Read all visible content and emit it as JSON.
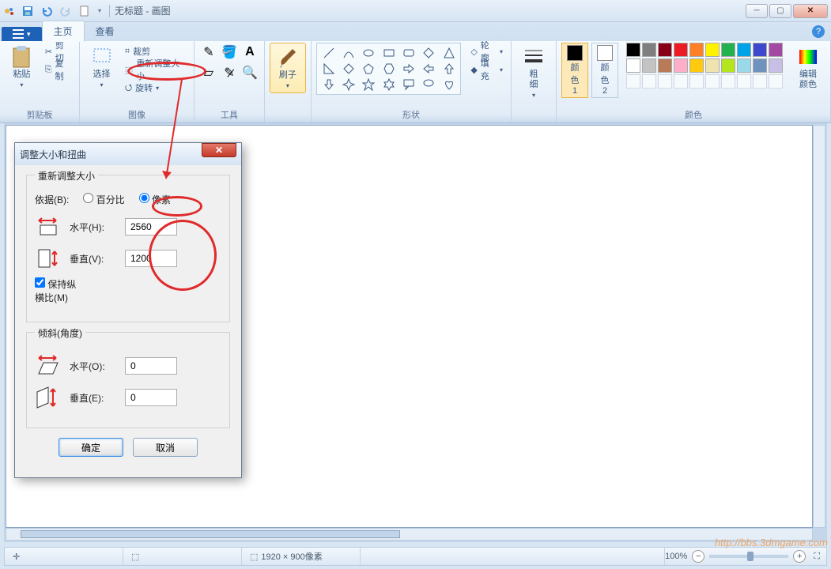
{
  "title": "无标题 - 画图",
  "qat": {
    "save": "保存",
    "undo": "撤销",
    "redo": "重做"
  },
  "tabs": {
    "file": "",
    "home": "主页",
    "view": "查看"
  },
  "ribbon": {
    "clipboard": {
      "label": "剪贴板",
      "paste": "粘贴",
      "cut": "剪切",
      "copy": "复制"
    },
    "image": {
      "label": "图像",
      "select": "选择",
      "crop": "裁剪",
      "resize": "重新调整大小",
      "rotate": "旋转"
    },
    "tools": {
      "label": "工具"
    },
    "brushes": {
      "label": "刷子"
    },
    "shapes": {
      "label": "形状",
      "outline": "轮廓",
      "fill": "填充"
    },
    "thickness": {
      "label": "粗\n细"
    },
    "colors": {
      "label": "颜色",
      "c1": "颜\n色 1",
      "c2": "颜\n色 2",
      "edit": "编辑颜色"
    }
  },
  "dialog": {
    "title": "调整大小和扭曲",
    "resize_legend": "重新调整大小",
    "by_label": "依据(B):",
    "percent": "百分比",
    "pixels": "像素",
    "horizontal": "水平(H):",
    "vertical": "垂直(V):",
    "h_value": "2560",
    "v_value": "1200",
    "aspect": "保持纵横比(M)",
    "skew_legend": "倾斜(角度)",
    "skew_h": "水平(O):",
    "skew_v": "垂直(E):",
    "skew_h_val": "0",
    "skew_v_val": "0",
    "ok": "确定",
    "cancel": "取消"
  },
  "status": {
    "dims": "1920 × 900像素",
    "zoom": "100%"
  },
  "palette_colors": [
    "#000",
    "#7f7f7f",
    "#880015",
    "#ed1c24",
    "#ff7f27",
    "#fff200",
    "#22b14c",
    "#00a2e8",
    "#3f48cc",
    "#a349a4",
    "#fff",
    "#c3c3c3",
    "#b97a57",
    "#ffaec9",
    "#ffc90e",
    "#efe4b0",
    "#b5e61d",
    "#99d9ea",
    "#7092be",
    "#c8bfe7"
  ],
  "watermark": "http://bbs.3dmgame.com"
}
